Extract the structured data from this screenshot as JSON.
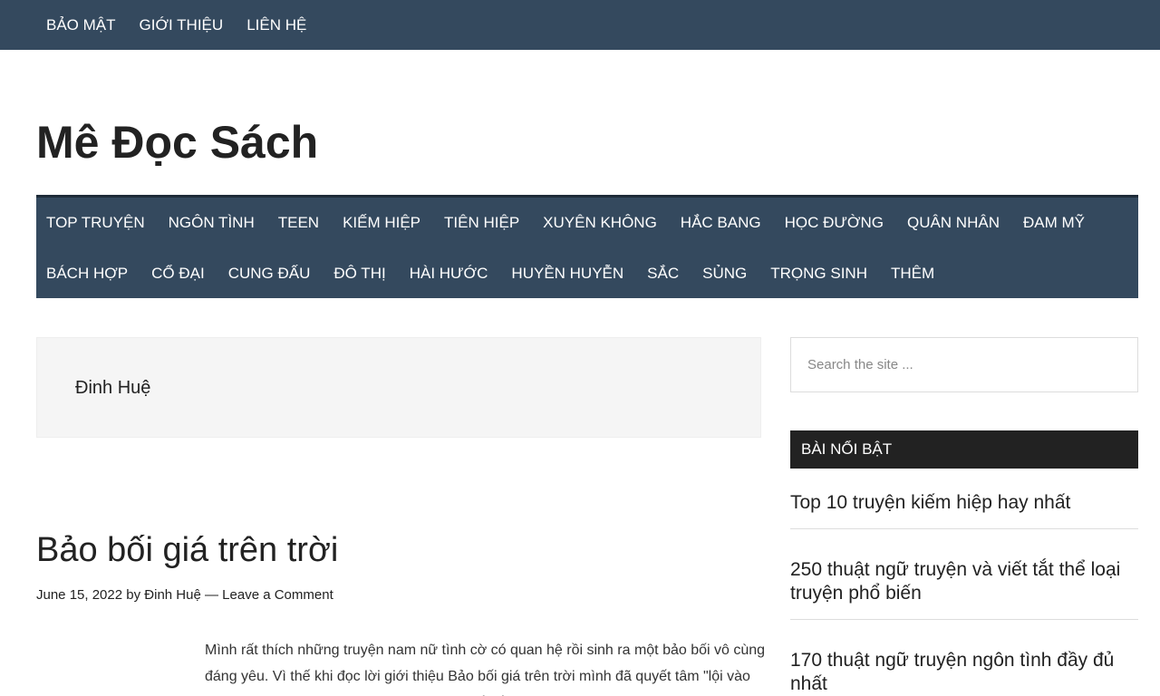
{
  "top_nav": {
    "items": [
      "BẢO MẬT",
      "GIỚI THIỆU",
      "LIÊN HỆ"
    ]
  },
  "site": {
    "title": "Mê Đọc Sách"
  },
  "main_nav": {
    "row1": [
      "TOP TRUYỆN",
      "NGÔN TÌNH",
      "TEEN",
      "KIẾM HIỆP",
      "TIÊN HIỆP",
      "XUYÊN KHÔNG",
      "HẮC BANG",
      "HỌC ĐƯỜNG",
      "QUÂN NHÂN",
      "ĐAM MỸ"
    ],
    "row2": [
      "BÁCH HỢP",
      "CỔ ĐẠI",
      "CUNG ĐẤU",
      "ĐÔ THỊ",
      "HÀI HƯỚC",
      "HUYỀN HUYỄN",
      "SẮC",
      "SỦNG",
      "TRỌNG SINH",
      "THÊM"
    ]
  },
  "archive": {
    "title": "Đinh Huệ"
  },
  "post": {
    "title": "Bảo bối giá trên trời",
    "date": "June 15, 2022",
    "by": "by",
    "author": "Đinh Huệ",
    "separator": "—",
    "comment_link": "Leave a Comment",
    "excerpt": "Mình rất thích những truyện nam nữ tình cờ có quan hệ rồi sinh ra một bảo bối vô cùng đáng yêu. Vì thế khi đọc lời giới thiệu Bảo bối giá trên trời mình đã quyết tâm \"lội vào đọc thử\". Sau một thời gian u mê không biết lối ra thì nay mình sẽ có"
  },
  "sidebar": {
    "search_placeholder": "Search the site ...",
    "widget_title": "BÀI NỔI BẬT",
    "featured": [
      "Top 10 truyện kiếm hiệp hay nhất",
      "250 thuật ngữ truyện và viết tắt thể loại truyện phổ biến",
      "170 thuật ngữ truyện ngôn tình đầy đủ nhất"
    ]
  },
  "colors": {
    "nav_background": "#34495e",
    "widget_header": "#222222",
    "archive_background": "#f5f5f5"
  }
}
